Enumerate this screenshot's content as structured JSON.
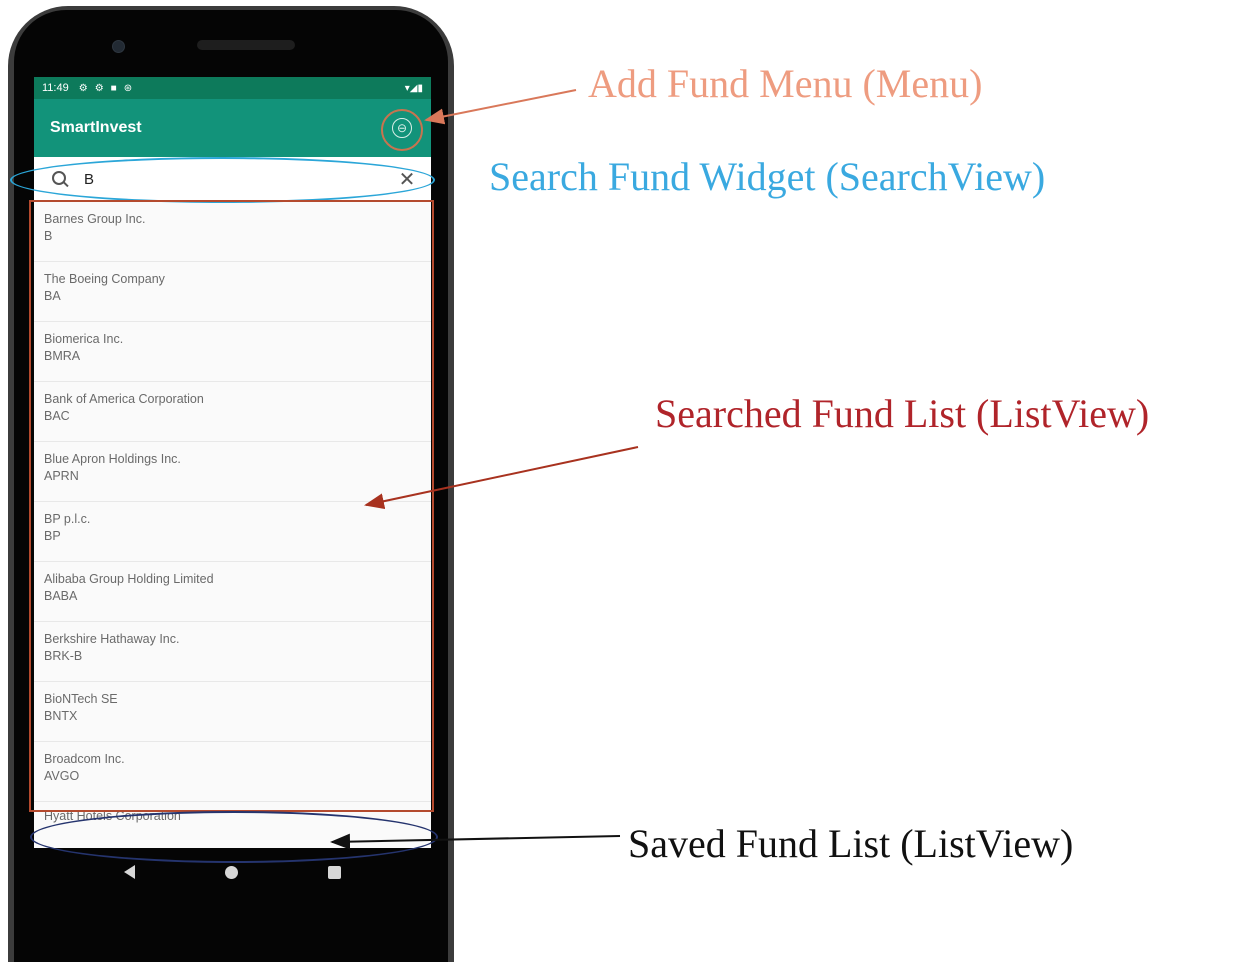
{
  "status_bar": {
    "time": "11:49",
    "icons": [
      "gear-icon",
      "gear-icon",
      "lock-icon",
      "sync-icon"
    ],
    "right_icons": "▾◢▮"
  },
  "app_bar": {
    "title": "SmartInvest",
    "menu_glyph": "⊖"
  },
  "search": {
    "value": "B"
  },
  "searched_funds": [
    {
      "name": "Barnes Group Inc.",
      "symbol": "B"
    },
    {
      "name": "The Boeing Company",
      "symbol": "BA"
    },
    {
      "name": "Biomerica Inc.",
      "symbol": "BMRA"
    },
    {
      "name": "Bank of America Corporation",
      "symbol": "BAC"
    },
    {
      "name": "Blue Apron Holdings Inc.",
      "symbol": "APRN"
    },
    {
      "name": "BP p.l.c.",
      "symbol": "BP"
    },
    {
      "name": "Alibaba Group Holding Limited",
      "symbol": "BABA"
    },
    {
      "name": "Berkshire Hathaway Inc.",
      "symbol": "BRK-B"
    },
    {
      "name": "BioNTech SE",
      "symbol": "BNTX"
    },
    {
      "name": "Broadcom Inc.",
      "symbol": "AVGO"
    }
  ],
  "saved_funds": [
    {
      "name": "Hyatt Hotels Corporation"
    }
  ],
  "annotations": {
    "menu": "Add Fund Menu  (Menu)",
    "search": "Search Fund Widget (SearchView)",
    "searched_list": "Searched Fund List  (ListView)",
    "saved_list": "Saved Fund List (ListView)"
  },
  "colors": {
    "status_bar": "#0d7a5b",
    "app_bar": "#12937a",
    "annot_menu": "#ee9c80",
    "annot_search": "#3aa9e0",
    "annot_list": "#b0242a",
    "annot_saved": "#111111"
  }
}
